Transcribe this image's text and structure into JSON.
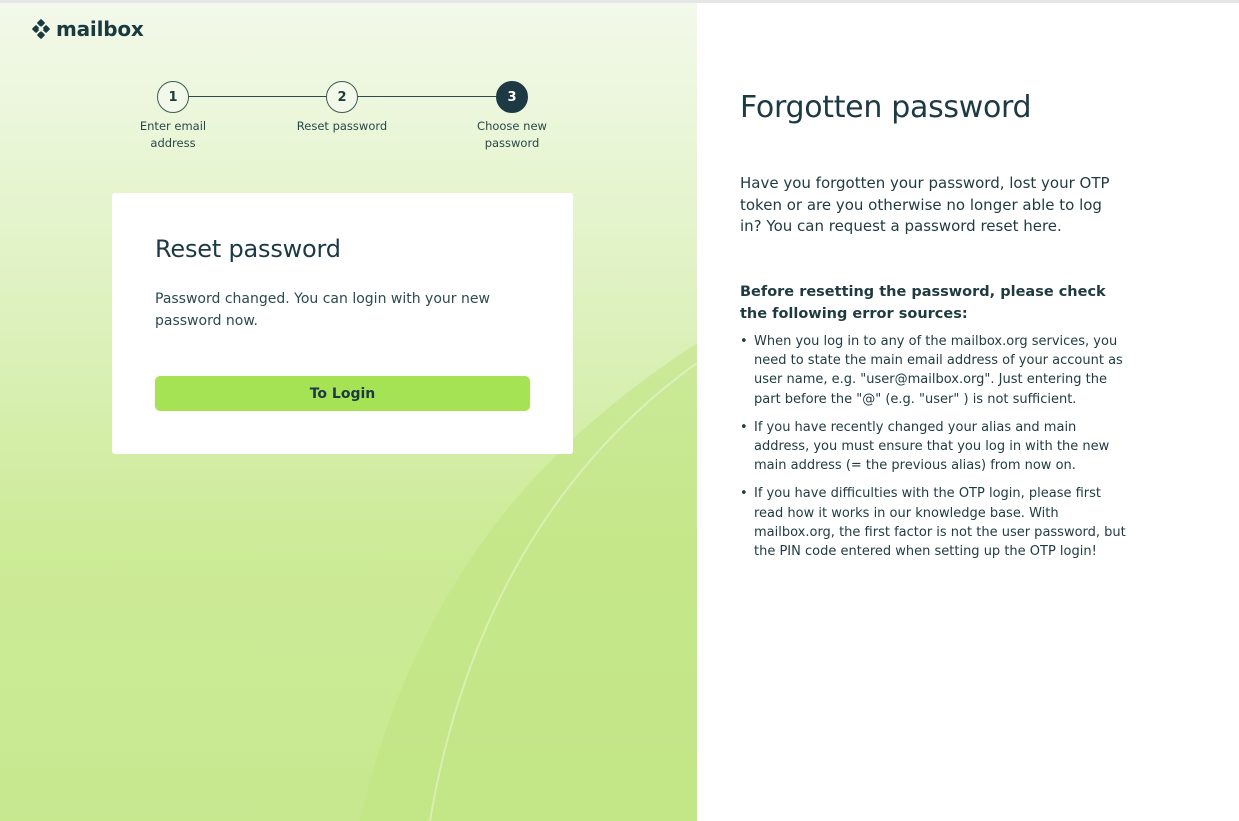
{
  "brand": {
    "logo_text": "mailbox"
  },
  "stepper": {
    "steps": [
      {
        "number": "1",
        "label": "Enter email address"
      },
      {
        "number": "2",
        "label": "Reset password"
      },
      {
        "number": "3",
        "label": "Choose new password"
      }
    ],
    "active_step": 3
  },
  "card": {
    "title": "Reset password",
    "message": "Password changed. You can login with your new password now.",
    "button_label": "To Login"
  },
  "info": {
    "title": "Forgotten password",
    "intro": "Have you forgotten your password, lost your OTP token or are you otherwise no longer able to log in? You can request a password reset here.",
    "check_heading": "Before resetting the password, please check the following error sources:",
    "items": [
      "When you log in to any of the mailbox.org services, you need to state the main email address of your account as user name, e.g. \"user@mailbox.org\". Just entering the part before the \"@\" (e.g. \"user\" ) is not sufficient.",
      "If you have recently changed your alias and main address, you must ensure that you log in with the new main address (= the previous alias) from now on.",
      "If you have difficulties with the OTP login, please first read how it works in our knowledge base. With mailbox.org, the first factor is not the user password, but the PIN code entered when setting up the OTP login!"
    ]
  },
  "colors": {
    "accent_button": "#a6e354",
    "dark_text": "#1d3a44",
    "left_panel_bg": "#cdeb98"
  }
}
